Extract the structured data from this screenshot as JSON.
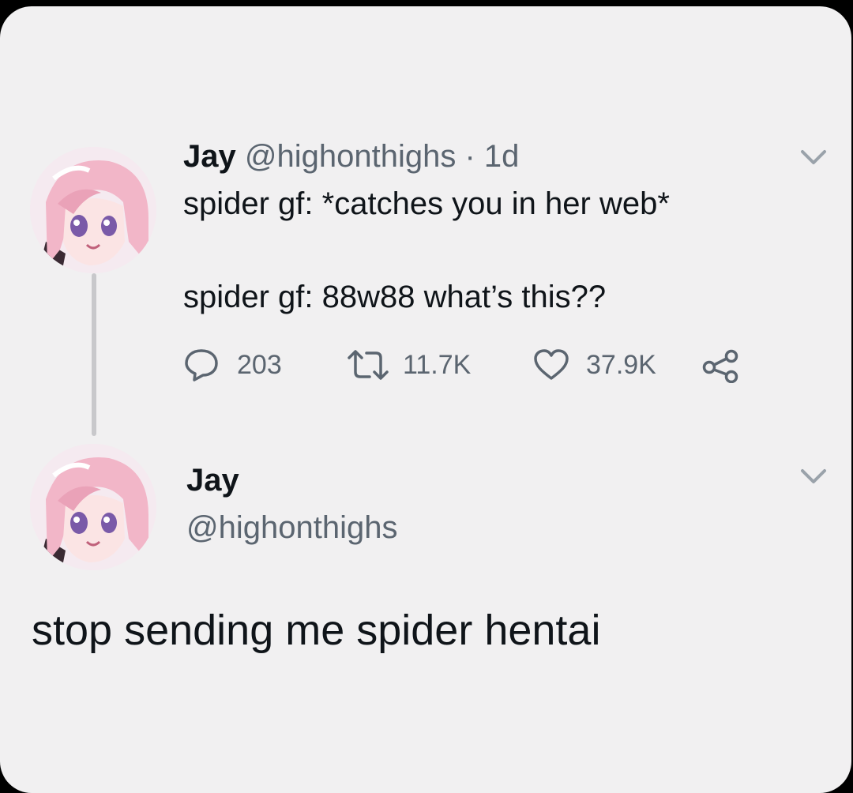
{
  "tweet": {
    "name": "Jay",
    "handle": "@highonthighs",
    "separator": "·",
    "time": "1d",
    "line1": "spider gf: *catches you in her web*",
    "line2": "spider gf: 88w88 what’s this??",
    "actions": {
      "replies": "203",
      "retweets": "11.7K",
      "likes": "37.9K"
    },
    "icons": {
      "reply": "reply-bubble-icon",
      "retweet": "retweet-icon",
      "like": "heart-icon",
      "share": "share-icon",
      "menu": "chevron-down-icon"
    }
  },
  "reply": {
    "name": "Jay",
    "handle": "@highonthighs",
    "text": "stop sending me spider hentai"
  },
  "colors": {
    "background": "#f1f0f1",
    "text": "#0f1419",
    "secondary": "#5b6570",
    "thread_line": "#c8c8cb",
    "avatar_hair": "#f2b6c8",
    "avatar_eyes": "#7a5aa8"
  }
}
